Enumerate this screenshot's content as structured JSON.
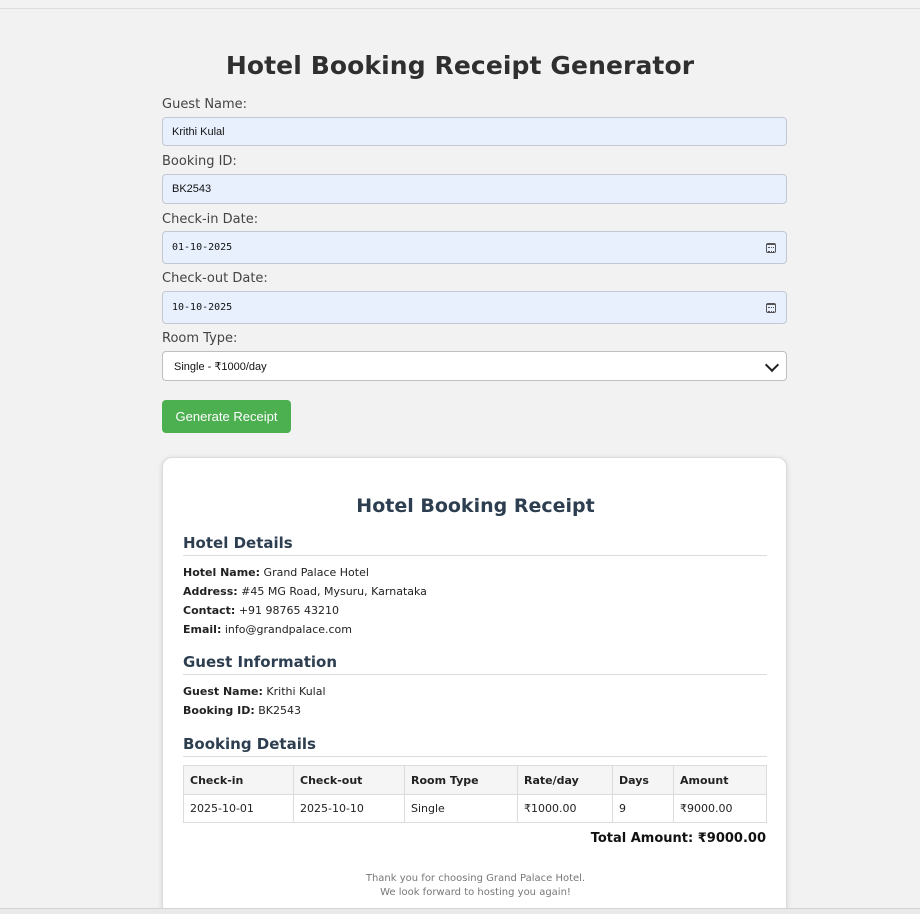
{
  "page": {
    "title": "Hotel Booking Receipt Generator"
  },
  "form": {
    "guest_name": {
      "label": "Guest Name:",
      "value": "Krithi Kulal"
    },
    "booking_id": {
      "label": "Booking ID:",
      "value": "BK2543"
    },
    "check_in": {
      "label": "Check-in Date:",
      "value": "01-10-2025"
    },
    "check_out": {
      "label": "Check-out Date:",
      "value": "10-10-2025"
    },
    "room_type": {
      "label": "Room Type:",
      "selected": "Single - ₹1000/day"
    },
    "generate_label": "Generate Receipt"
  },
  "receipt": {
    "title": "Hotel Booking Receipt",
    "hotel": {
      "heading": "Hotel Details",
      "name_label": "Hotel Name:",
      "name": "Grand Palace Hotel",
      "address_label": "Address:",
      "address": "#45 MG Road, Mysuru, Karnataka",
      "contact_label": "Contact:",
      "contact": "+91 98765 43210",
      "email_label": "Email:",
      "email": "info@grandpalace.com"
    },
    "guest": {
      "heading": "Guest Information",
      "name_label": "Guest Name:",
      "name": "Krithi Kulal",
      "id_label": "Booking ID:",
      "id": "BK2543"
    },
    "booking": {
      "heading": "Booking Details",
      "columns": [
        "Check-in",
        "Check-out",
        "Room Type",
        "Rate/day",
        "Days",
        "Amount"
      ],
      "rows": [
        [
          "2025-10-01",
          "2025-10-10",
          "Single",
          "₹1000.00",
          "9",
          "₹9000.00"
        ]
      ],
      "total": "Total Amount: ₹9000.00"
    },
    "footer": {
      "line1": "Thank you for choosing Grand Palace Hotel.",
      "line2": "We look forward to hosting you again!"
    }
  },
  "colors": {
    "button": "#4caf50",
    "input_bg": "#e8f0fe",
    "heading": "#2c3e50"
  },
  "icons": [
    "calendar-icon",
    "chevron-down-icon"
  ]
}
